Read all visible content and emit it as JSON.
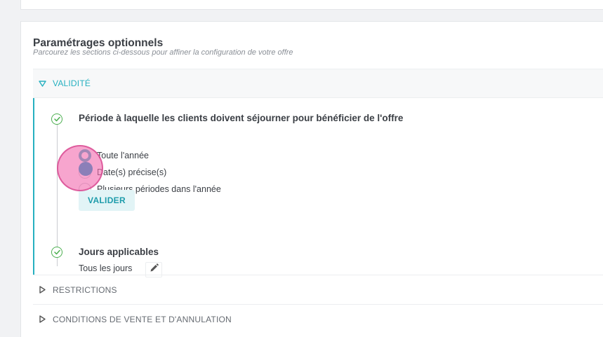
{
  "panel": {
    "title": "Paramétrages optionnels",
    "subtitle": "Parcourez les sections ci-dessous pour affiner la configuration de votre offre"
  },
  "sections": {
    "validite": {
      "label": "VALIDITÉ",
      "expanded": true,
      "steps": {
        "period": {
          "title": "Période à laquelle les clients doivent séjourner pour bénéficier de l'offre",
          "options": [
            {
              "label": "Toute l'année",
              "selected": true
            },
            {
              "label": "Date(s) précise(s)",
              "selected": false
            },
            {
              "label": "Plusieurs périodes dans l'année",
              "selected": false
            }
          ],
          "validate_label": "VALIDER"
        },
        "days": {
          "title": "Jours applicables",
          "value": "Tous les jours"
        }
      }
    },
    "restrictions": {
      "label": "RESTRICTIONS",
      "expanded": false
    },
    "conditions": {
      "label": "CONDITIONS DE VENTE ET D'ANNULATION",
      "expanded": false
    }
  },
  "colors": {
    "accent": "#26b0c0",
    "success": "#4caf50",
    "click_marker": "#f26eb0"
  },
  "icons": {
    "section_open": "triangle-down-icon",
    "section_closed": "triangle-right-icon",
    "step_done": "check-circle-icon",
    "edit": "pencil-icon"
  }
}
